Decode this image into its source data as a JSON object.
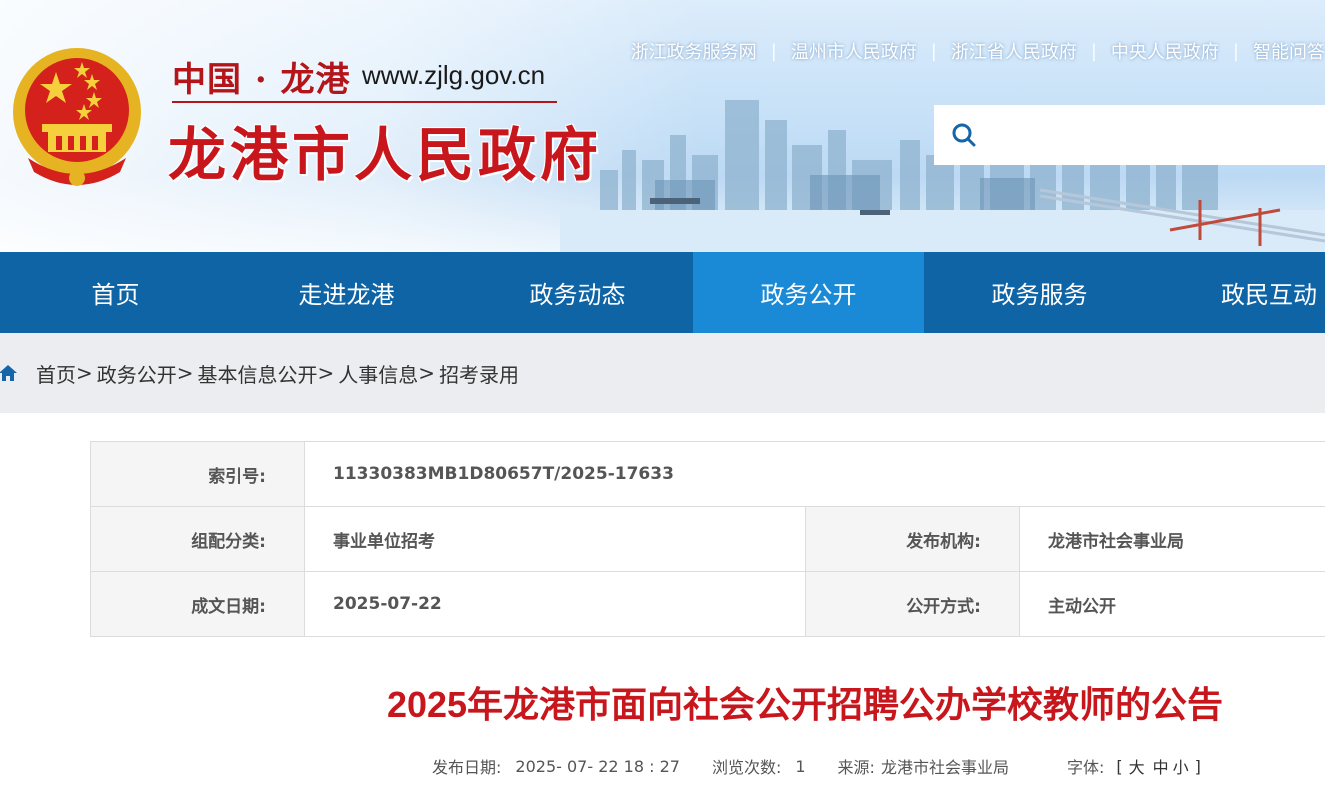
{
  "header": {
    "slogan": "中国 · 龙港",
    "url": "www.zjlg.gov.cn",
    "site_name": "龙港市人民政府",
    "links": [
      "浙江政务服务网",
      "温州市人民政府",
      "浙江省人民政府",
      "中央人民政府",
      "智能问答"
    ],
    "search": {
      "placeholder": ""
    },
    "colors": {
      "nav": "#0f64a6",
      "nav_active": "#1a8ad6",
      "title_red": "#c8161d"
    }
  },
  "nav": {
    "items": [
      {
        "label": "首页",
        "active": false
      },
      {
        "label": "走进龙港",
        "active": false
      },
      {
        "label": "政务动态",
        "active": false
      },
      {
        "label": "政务公开",
        "active": true
      },
      {
        "label": "政务服务",
        "active": false
      },
      {
        "label": "政民互动",
        "active": false
      }
    ]
  },
  "breadcrumb": {
    "items": [
      "首页",
      "政务公开",
      "基本信息公开",
      "人事信息",
      "招考录用"
    ],
    "separator": ">"
  },
  "info": {
    "index_label": "索引号:",
    "index_value": "11330383MB1D80657T/2025-17633",
    "category_label": "组配分类:",
    "category_value": "事业单位招考",
    "publisher_label": "发布机构:",
    "publisher_value": "龙港市社会事业局",
    "date_label": "成文日期:",
    "date_value": "2025-07-22",
    "disclosure_label": "公开方式:",
    "disclosure_value": "主动公开"
  },
  "article": {
    "title": "2025年龙港市面向社会公开招聘公办学校教师的公告",
    "meta": {
      "date_label": "发布日期:",
      "date_value": "2025- 07- 22 18 : 27",
      "views_label": "浏览次数:",
      "views_value": "1",
      "source_label": "来源:",
      "source_value": "龙港市社会事业局",
      "font_label": "字体:",
      "font_open": "[",
      "font_large": "大",
      "font_medium": "中",
      "font_small": "小",
      "font_close": "]"
    }
  }
}
